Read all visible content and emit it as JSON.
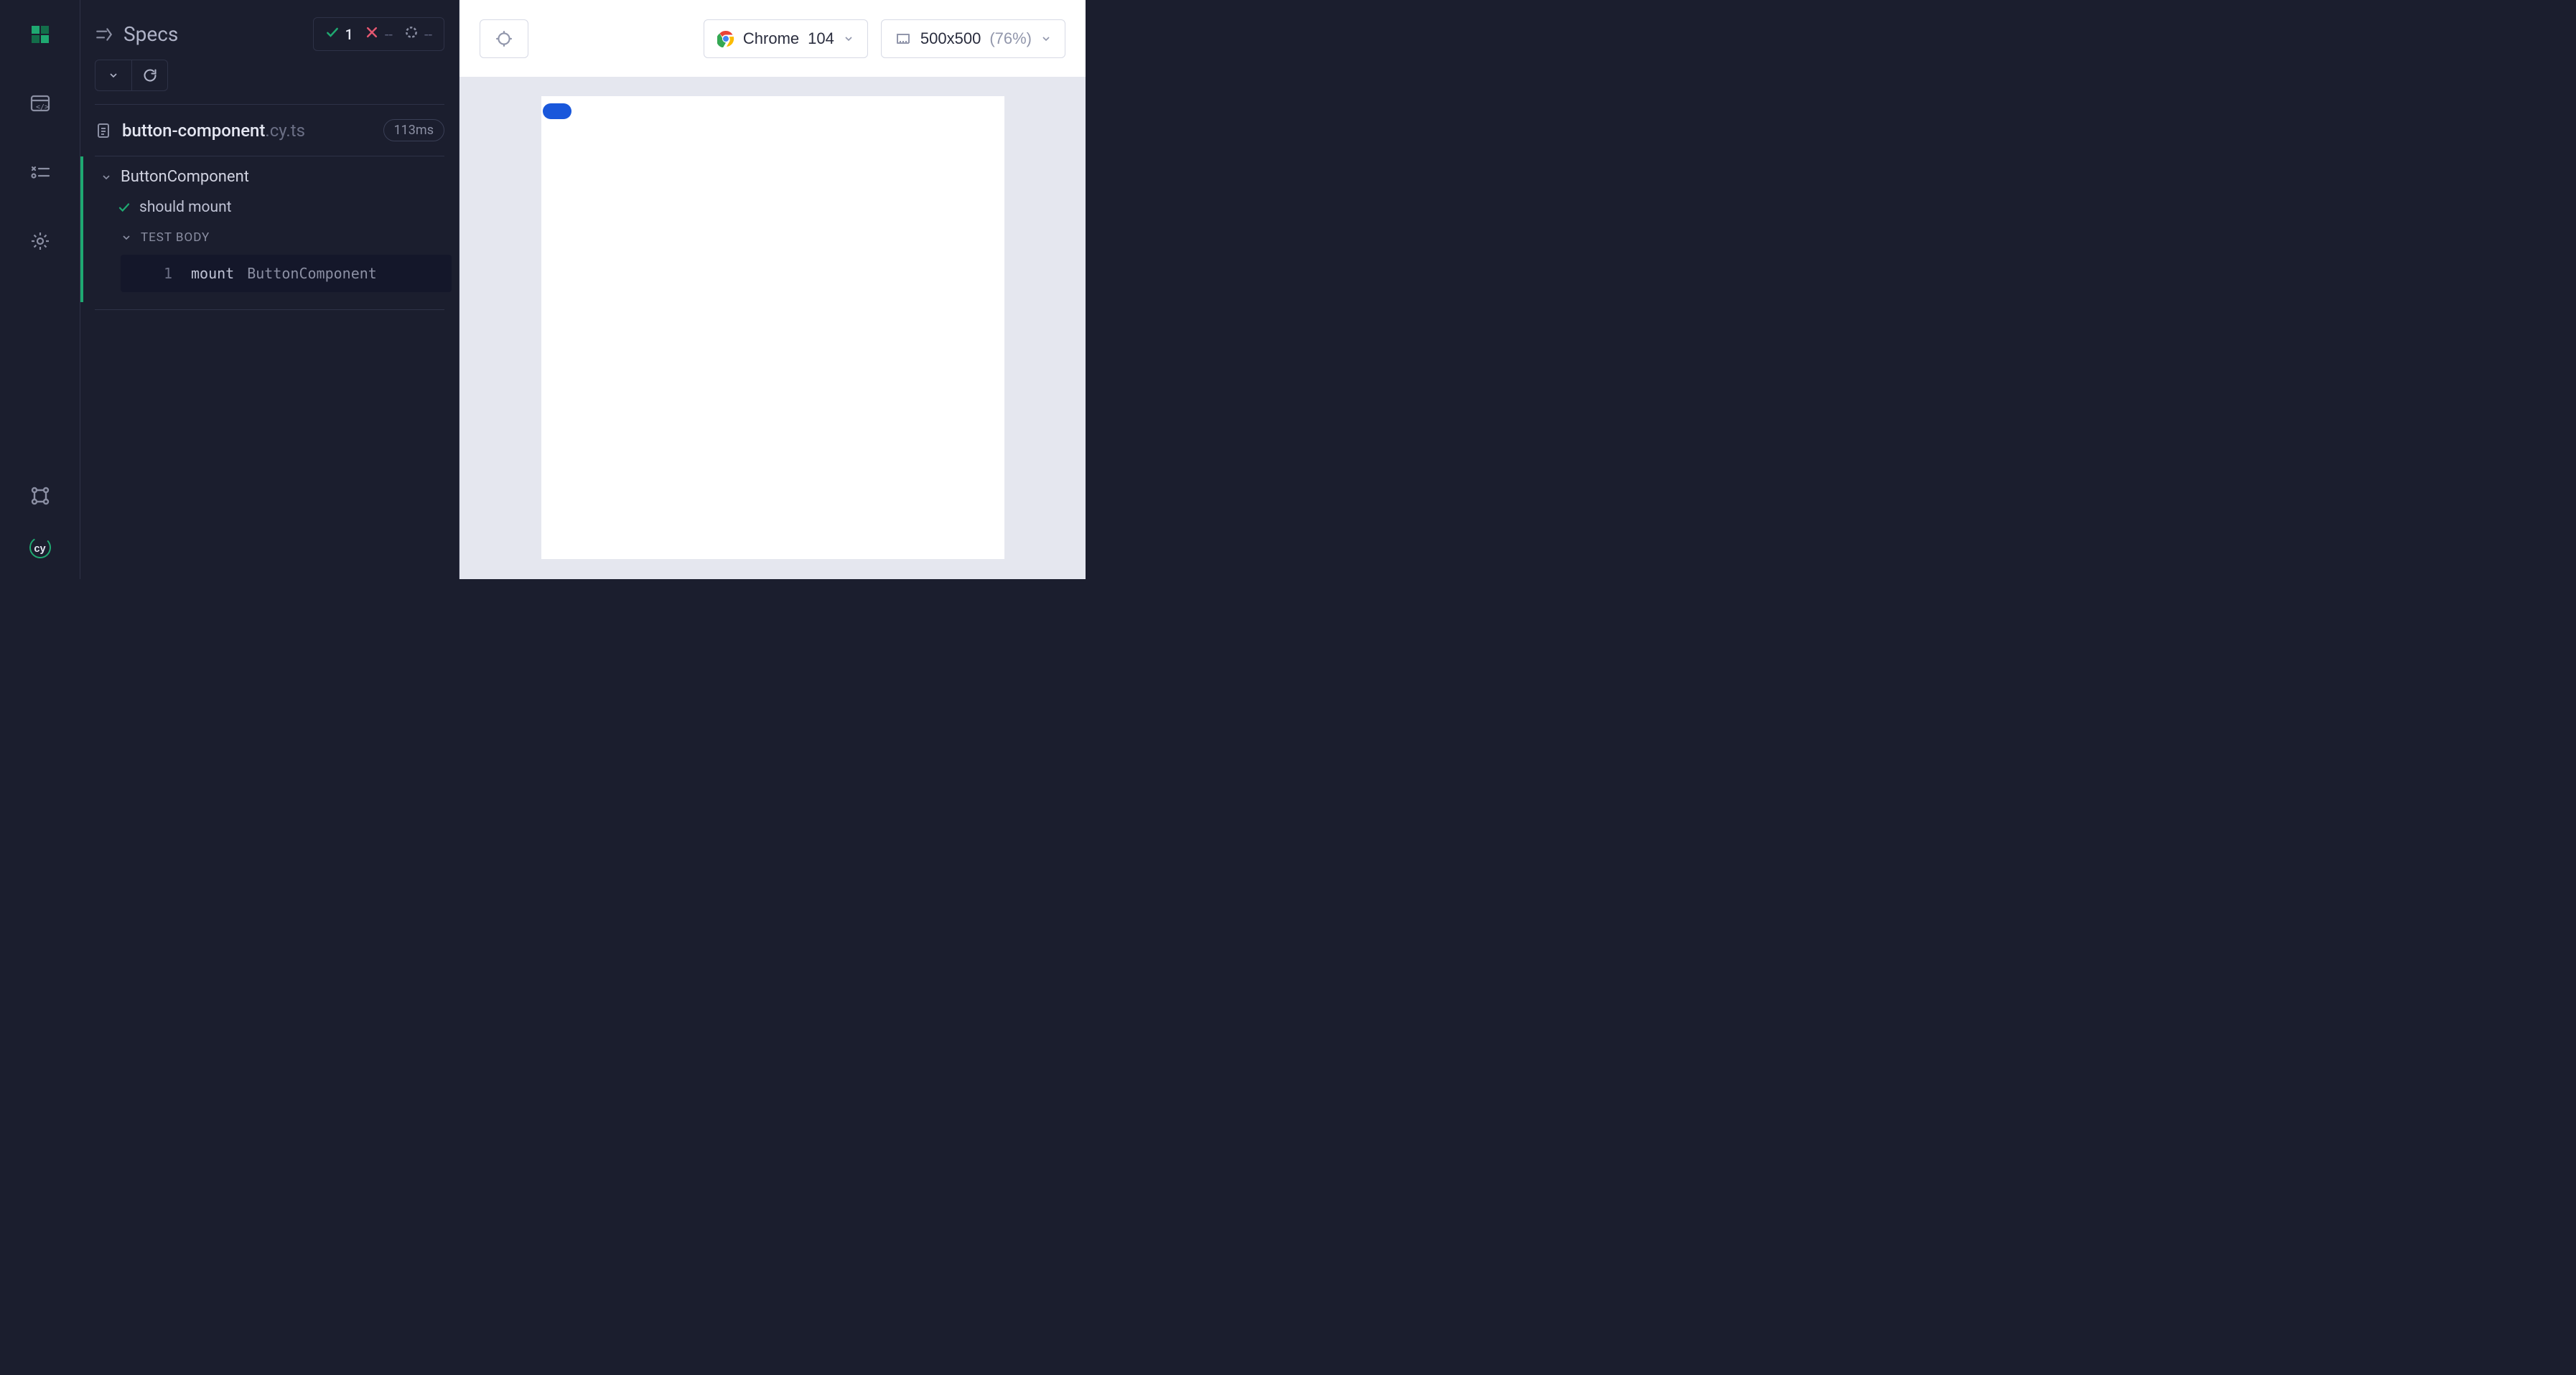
{
  "rail": {
    "items": [
      "logo",
      "specs",
      "runs",
      "settings"
    ],
    "bottom": [
      "keyboard",
      "cypress"
    ]
  },
  "header": {
    "title": "Specs",
    "stats": {
      "passed": "1",
      "failed": "--",
      "pending": "--"
    }
  },
  "spec": {
    "filename": "button-component",
    "ext": ".cy.ts",
    "duration": "113ms"
  },
  "suite": {
    "name": "ButtonComponent",
    "tests": [
      {
        "title": "should mount"
      }
    ],
    "body_label": "TEST BODY",
    "commands": [
      {
        "index": "1",
        "name": "mount",
        "arg": "ButtonComponent"
      }
    ]
  },
  "aut": {
    "browser": {
      "name": "Chrome",
      "version": "104"
    },
    "viewport": {
      "size": "500x500",
      "scale": "(76%)"
    }
  }
}
